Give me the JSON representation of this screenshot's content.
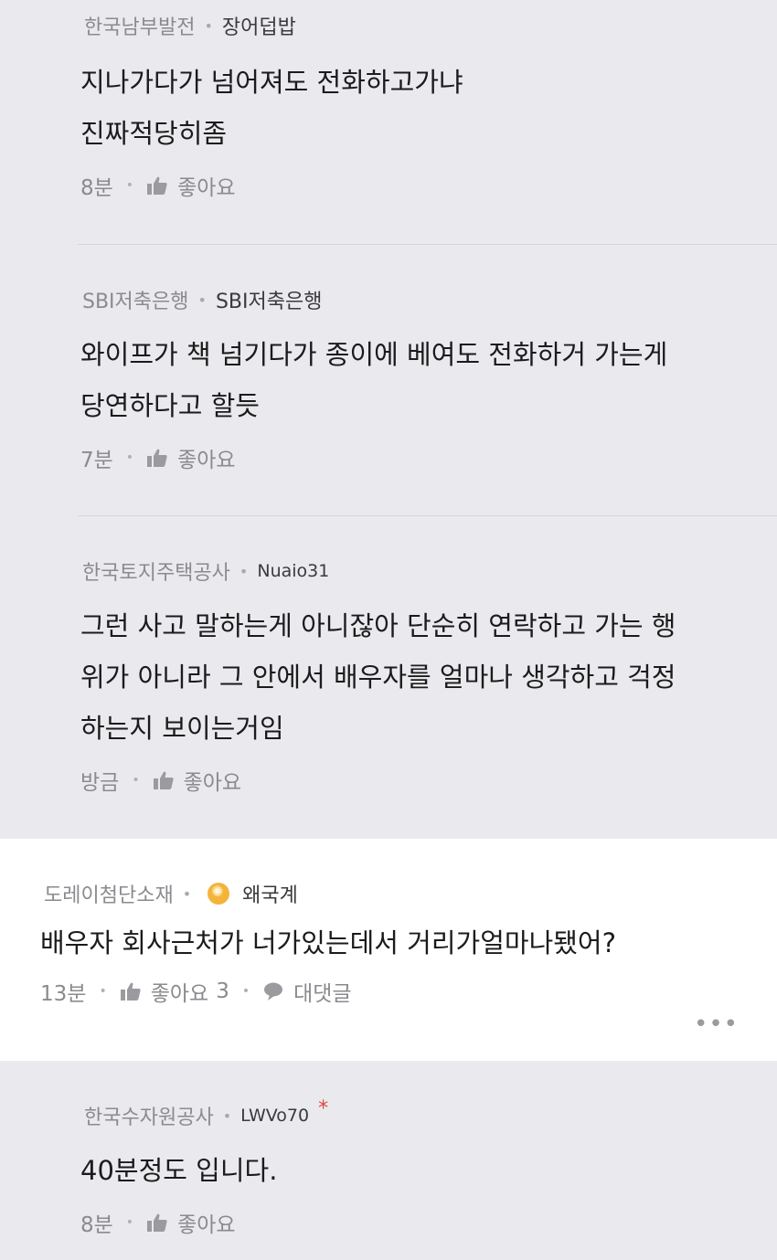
{
  "replies_top": [
    {
      "company": "한국남부발전",
      "nickname": "장어덥밥",
      "lines": [
        "지나가다가 넘어져도 전화하고가냐",
        "진짜적당히좀"
      ],
      "time": "8분",
      "like_label": "좋아요"
    },
    {
      "company": "SBI저축은행",
      "nickname": "SBI저축은행",
      "lines": [
        "와이프가 책 넘기다가 종이에 베여도 전화하거 가는게",
        "당연하다고 할듯"
      ],
      "time": "7분",
      "like_label": "좋아요"
    },
    {
      "company": "한국토지주택공사",
      "nickname": "Nuaio31",
      "lines": [
        "그런 사고 말하는게 아니잖아 단순히 연락하고 가는 행",
        "위가 아니라 그 안에서 배우자를 얼마나 생각하고 걱정",
        "하는지 보이는거임"
      ],
      "time": "방금",
      "like_label": "좋아요"
    }
  ],
  "main_comment": {
    "company": "도레이첨단소재",
    "nickname": "왜국계",
    "text": "배우자 회사근처가 너가있는데서 거리가얼마나됐어?",
    "time": "13분",
    "like_label": "좋아요",
    "like_count": "3",
    "reply_label": "대댓글",
    "more": "•••"
  },
  "reply_bottom": {
    "company": "한국수자원공사",
    "nickname": "LWVo70",
    "star": "*",
    "text": "40분정도 입니다.",
    "time": "8분",
    "like_label": "좋아요"
  },
  "icons": {
    "like": "thumbs-up-icon",
    "comment": "speech-bubble-icon",
    "badge": "company-badge-icon"
  },
  "colors": {
    "reply_bg": "#eaeaee",
    "main_bg": "#ffffff",
    "star": "#e0453a"
  }
}
